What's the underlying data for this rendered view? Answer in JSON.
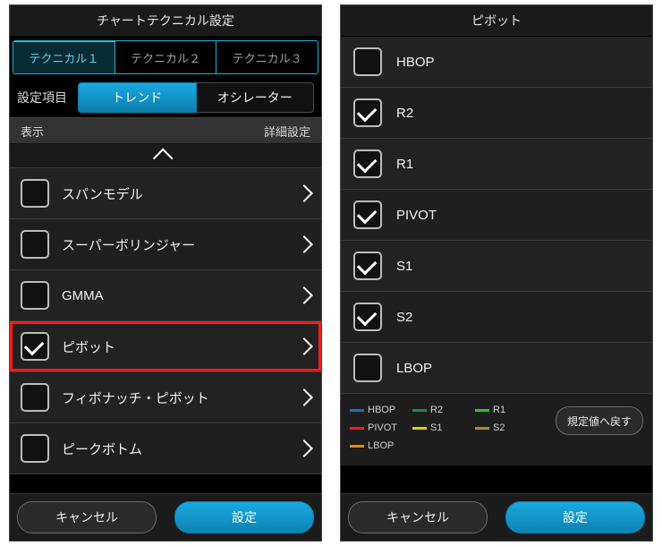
{
  "left": {
    "title": "チャートテクニカル設定",
    "tabs": [
      "テクニカル１",
      "テクニカル２",
      "テクニカル３"
    ],
    "active_tab": 0,
    "setting_label": "設定項目",
    "segments": [
      "トレンド",
      "オシレーター"
    ],
    "active_segment": 0,
    "col_display": "表示",
    "col_detail": "詳細設定",
    "items": [
      {
        "label": "スパンモデル",
        "checked": false,
        "highlighted": false
      },
      {
        "label": "スーパーボリンジャー",
        "checked": false,
        "highlighted": false
      },
      {
        "label": "GMMA",
        "checked": false,
        "highlighted": false
      },
      {
        "label": "ピボット",
        "checked": true,
        "highlighted": true
      },
      {
        "label": "フィボナッチ・ピボット",
        "checked": false,
        "highlighted": false
      },
      {
        "label": "ピークボトム",
        "checked": false,
        "highlighted": false
      }
    ],
    "cancel": "キャンセル",
    "apply": "設定"
  },
  "right": {
    "title": "ピボット",
    "items": [
      {
        "label": "HBOP",
        "checked": false
      },
      {
        "label": "R2",
        "checked": true
      },
      {
        "label": "R1",
        "checked": true
      },
      {
        "label": "PIVOT",
        "checked": true
      },
      {
        "label": "S1",
        "checked": true
      },
      {
        "label": "S2",
        "checked": true
      },
      {
        "label": "LBOP",
        "checked": false
      }
    ],
    "legend": [
      {
        "label": "HBOP",
        "color": "#1f6fb0",
        "style": "background:#1f6fb0"
      },
      {
        "label": "R2",
        "color": "#1e8a3b",
        "style": "background:#1e8a3b"
      },
      {
        "label": "R1",
        "color": "#29c23a",
        "style": "background:#29c23a"
      },
      {
        "label": "PIVOT",
        "color": "#ff1a1a",
        "style": "background:#ff1a1a"
      },
      {
        "label": "S1",
        "color": "#e0d100",
        "style": "background:#e0d100"
      },
      {
        "label": "S2",
        "color": "#b08b2e",
        "style": "background:#b08b2e"
      },
      {
        "label": "LBOP",
        "color": "#e08a1a",
        "style": "background:#e08a1a"
      }
    ],
    "reset": "規定値へ戻す",
    "cancel": "キャンセル",
    "apply": "設定"
  }
}
